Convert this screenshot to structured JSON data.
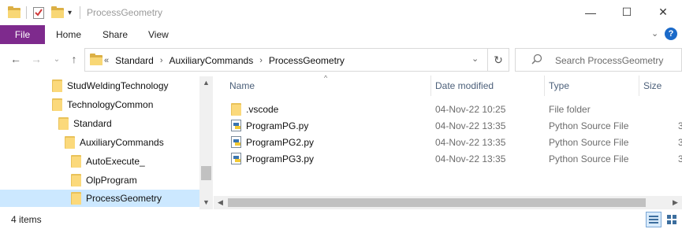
{
  "window": {
    "title": "ProcessGeometry",
    "minimize_glyph": "—",
    "maximize_glyph": "☐",
    "close_glyph": "✕"
  },
  "ribbon": {
    "file_label": "File",
    "tabs": [
      "Home",
      "Share",
      "View"
    ],
    "expand_glyph": "⌄",
    "help_glyph": "?"
  },
  "nav": {
    "back_glyph": "←",
    "forward_glyph": "→",
    "recent_glyph": "⌄",
    "up_glyph": "↑",
    "overflow": "«",
    "breadcrumbs": [
      "Standard",
      "AuxiliaryCommands",
      "ProcessGeometry"
    ],
    "refresh_glyph": "↻",
    "dropdown_glyph": "⌄"
  },
  "search": {
    "placeholder": "Search ProcessGeometry",
    "icon_glyph": "⚲"
  },
  "tree": {
    "items": [
      {
        "label": "StudWeldingTechnology"
      },
      {
        "label": "TechnologyCommon"
      },
      {
        "label": "Standard"
      },
      {
        "label": "AuxiliaryCommands"
      },
      {
        "label": "AutoExecute_"
      },
      {
        "label": "OlpProgram"
      },
      {
        "label": "ProcessGeometry"
      }
    ],
    "selected_index": 6
  },
  "list": {
    "columns": {
      "name": "Name",
      "date": "Date modified",
      "type": "Type",
      "size": "Size"
    },
    "rows": [
      {
        "name": ".vscode",
        "date": "04-Nov-22 10:25",
        "type": "File folder",
        "size": "",
        "icon": "folder-icon"
      },
      {
        "name": "ProgramPG.py",
        "date": "04-Nov-22 13:35",
        "type": "Python Source File",
        "size": "3",
        "icon": "python-file-icon"
      },
      {
        "name": "ProgramPG2.py",
        "date": "04-Nov-22 13:35",
        "type": "Python Source File",
        "size": "3",
        "icon": "python-file-icon"
      },
      {
        "name": "ProgramPG3.py",
        "date": "04-Nov-22 13:35",
        "type": "Python Source File",
        "size": "3",
        "icon": "python-file-icon"
      }
    ]
  },
  "status": {
    "item_count": "4 items"
  },
  "colors": {
    "file_tab": "#7e2a8d",
    "selection": "#cce8ff",
    "folder": "#f8d775"
  }
}
